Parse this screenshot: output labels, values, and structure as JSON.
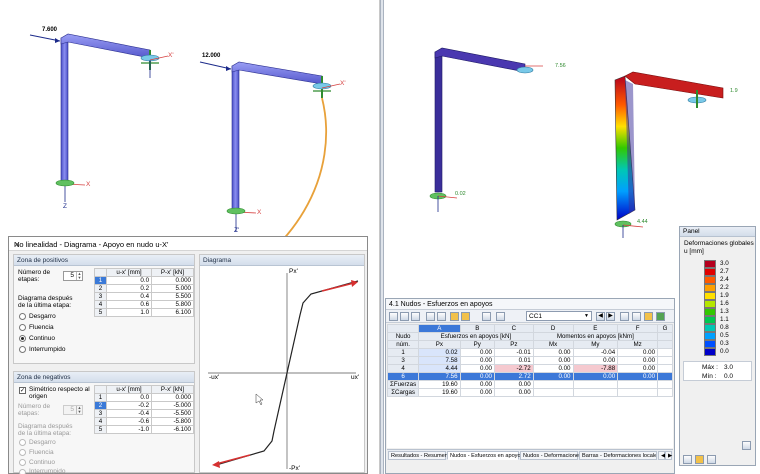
{
  "colors": {
    "member": "#6a6ed6",
    "member_edge": "#2b2f8f",
    "arrow": "#d64040",
    "curve": "#e8a13a",
    "selection": "#3c78d8"
  },
  "left_view": {
    "load1": "7.600",
    "load2": "12.000",
    "axes": {
      "x": "X",
      "z": "Z",
      "z_prime": "Z'",
      "x_prime": "X'"
    }
  },
  "right_view": {
    "load1": "7.56",
    "load2": "1.9",
    "support_label_1": "0.02",
    "support_label_2": "4.44"
  },
  "dialog": {
    "title": "No linealidad - Diagrama - Apoyo en nudo u-X'",
    "close": "✕",
    "positive_group": "Zona de positivos",
    "steps_label_1": "Número de",
    "steps_label_2": "etapas:",
    "steps_value": "5",
    "after_label_1": "Diagrama después",
    "after_label_2": "de la última etapa:",
    "options": [
      "Desgarro",
      "Fluencia",
      "Continuo",
      "Interrumpido"
    ],
    "selected_option": "Continuo",
    "col_u": "u-x' [mm]",
    "col_p": "P-x' [kN]",
    "pos_rows": [
      [
        "1",
        "0.0",
        "0.000"
      ],
      [
        "2",
        "0.2",
        "5.000"
      ],
      [
        "3",
        "0.4",
        "5.500"
      ],
      [
        "4",
        "0.6",
        "5.800"
      ],
      [
        "5",
        "1.0",
        "6.100"
      ]
    ],
    "diagram_group": "Diagrama",
    "neg_group": "Zona de negativos",
    "symmetric_label_1": "Simétrico respecto al",
    "symmetric_label_2": "origen",
    "neg_steps_label_1": "Número de",
    "neg_steps_label_2": "etapas:",
    "neg_steps_value": "5",
    "neg_after_label_1": "Diagrama después",
    "neg_after_label_2": "de la última etapa:",
    "neg_rows": [
      [
        "1",
        "0.0",
        "0.000"
      ],
      [
        "2",
        "-0.2",
        "-5.000"
      ],
      [
        "3",
        "-0.4",
        "-5.500"
      ],
      [
        "4",
        "-0.6",
        "-5.800"
      ],
      [
        "5",
        "-1.0",
        "-6.100"
      ]
    ],
    "axis_p": "Px'",
    "axis_u": "ux'",
    "axis_u_neg": "-ux'",
    "axis_p_neg": "-Px'"
  },
  "results": {
    "title": "4.1 Nudos - Esfuerzos en apoyos",
    "load_case": "CC1",
    "col_letters": [
      "A",
      "B",
      "C",
      "D",
      "E",
      "F",
      "G"
    ],
    "group_force": "Esfuerzos en apoyos [kN]",
    "group_moment": "Momentos en apoyos [kNm]",
    "node_label_1": "Nudo",
    "node_label_2": "núm.",
    "sub_headers": [
      "Px",
      "Py",
      "Pz",
      "Mx",
      "My",
      "Mz"
    ],
    "rows": [
      {
        "n": "1",
        "v": [
          "0.02",
          "0.00",
          "-0.01",
          "0.00",
          "-0.04",
          "0.00"
        ]
      },
      {
        "n": "3",
        "v": [
          "7.58",
          "0.00",
          "0.01",
          "0.00",
          "0.00",
          "0.00"
        ]
      },
      {
        "n": "4",
        "v": [
          "4.44",
          "0.00",
          "-2.72",
          "0.00",
          "-7.88",
          "0.00"
        ]
      },
      {
        "n": "6",
        "v": [
          "7.56",
          "0.00",
          "2.72",
          "0.00",
          "0.00",
          "0.00"
        ]
      },
      {
        "n": "ΣFuerzas",
        "v": [
          "19.60",
          "0.00",
          "0.00",
          "",
          "",
          ""
        ]
      },
      {
        "n": "ΣCargas",
        "v": [
          "19.60",
          "0.00",
          "0.00",
          "",
          "",
          ""
        ]
      }
    ],
    "tabs": [
      "Resultados - Resumen",
      "Nudos - Esfuerzos en apoyos",
      "Nudos - Deformaciones",
      "Barras - Deformaciones locales"
    ]
  },
  "panel": {
    "title": "Panel",
    "heading_1": "Deformaciones globales",
    "heading_2": "u [mm]",
    "legend": [
      {
        "v": "3.0",
        "c": "#b4001e"
      },
      {
        "v": "2.7",
        "c": "#e00000"
      },
      {
        "v": "2.4",
        "c": "#ff5a00"
      },
      {
        "v": "2.2",
        "c": "#ffa000"
      },
      {
        "v": "1.9",
        "c": "#ffe000"
      },
      {
        "v": "1.6",
        "c": "#b4e600"
      },
      {
        "v": "1.3",
        "c": "#32c800"
      },
      {
        "v": "1.1",
        "c": "#00c850"
      },
      {
        "v": "0.8",
        "c": "#00c8b4"
      },
      {
        "v": "0.5",
        "c": "#00a0ff"
      },
      {
        "v": "0.3",
        "c": "#0050ff"
      },
      {
        "v": "0.0",
        "c": "#0000c8"
      }
    ],
    "max_label": "Máx :",
    "max_value": "3.0",
    "min_label": "Mín :",
    "min_value": "0.0"
  }
}
